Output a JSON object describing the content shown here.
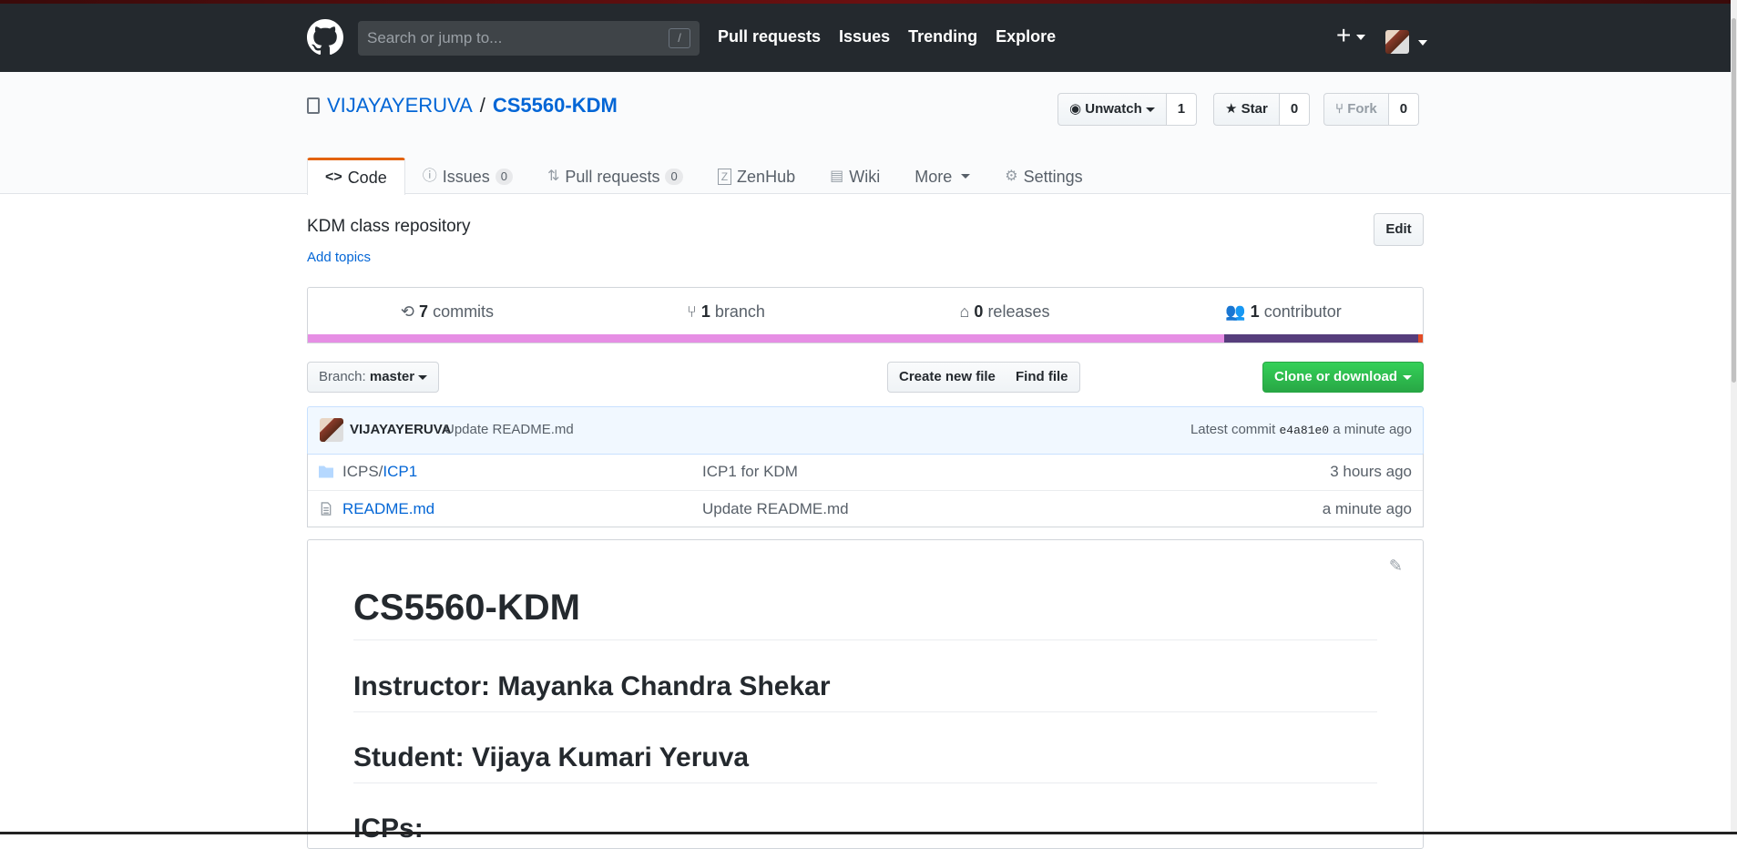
{
  "header": {
    "search_placeholder": "Search or jump to...",
    "search_shortcut": "/",
    "nav": [
      "Pull requests",
      "Issues",
      "Trending",
      "Explore"
    ],
    "plus_label": "+"
  },
  "repo": {
    "owner": "VIJAYAYERUVA",
    "separator": "/",
    "name": "CS5560-KDM",
    "watch_label": "Unwatch",
    "watch_count": "1",
    "star_label": "Star",
    "star_count": "0",
    "fork_label": "Fork",
    "fork_count": "0"
  },
  "tabs": [
    {
      "label": "Code",
      "icon": "<>"
    },
    {
      "label": "Issues",
      "count": "0"
    },
    {
      "label": "Pull requests",
      "count": "0"
    },
    {
      "label": "ZenHub"
    },
    {
      "label": "Wiki"
    },
    {
      "label": "More"
    },
    {
      "label": "Settings"
    }
  ],
  "about": {
    "description": "KDM class repository",
    "add_topics": "Add topics",
    "edit_label": "Edit"
  },
  "summary": {
    "commits_count": "7",
    "commits_label": "commits",
    "branch_count": "1",
    "branch_label": "branch",
    "releases_count": "0",
    "releases_label": "releases",
    "contributor_count": "1",
    "contributor_label": "contributor",
    "languages": [
      {
        "color": "#e68ee4",
        "fraction": 0.822
      },
      {
        "color": "#563d7c",
        "fraction": 0.174
      },
      {
        "color": "#e34c26",
        "fraction": 0.004
      }
    ]
  },
  "filebar": {
    "branch_prefix": "Branch:",
    "branch_name": "master",
    "create_file": "Create new file",
    "find_file": "Find file",
    "clone": "Clone or download"
  },
  "commit": {
    "author": "VIJAYAYERUVA",
    "message": "Update README.md",
    "latest_label": "Latest commit",
    "sha": "e4a81e0",
    "age": "a minute ago"
  },
  "files": [
    {
      "prefix": "ICPS/",
      "name": "ICP1",
      "message": "ICP1 for KDM",
      "age": "3 hours ago",
      "type": "folder"
    },
    {
      "prefix": "",
      "name": "README.md",
      "message": "Update README.md",
      "age": "a minute ago",
      "type": "file"
    }
  ],
  "readme": {
    "h1": "CS5560-KDM",
    "h2_instructor": "Instructor: Mayanka Chandra Shekar",
    "h2_student": "Student: Vijaya Kumari Yeruva",
    "h2_icps": "ICPs:"
  }
}
